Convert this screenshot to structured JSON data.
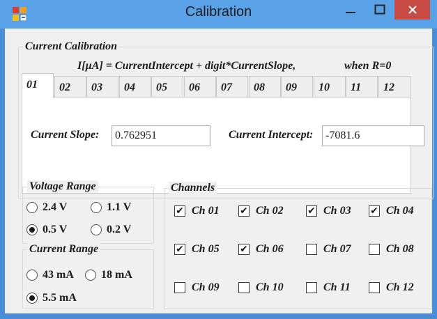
{
  "window": {
    "title": "Calibration"
  },
  "current_calibration": {
    "legend": "Current Calibration",
    "formula": "I[µA] = CurrentIntercept + digit*CurrentSlope,",
    "formula_condition": "when R=0",
    "tabs": [
      "01",
      "02",
      "03",
      "04",
      "05",
      "06",
      "07",
      "08",
      "09",
      "10",
      "11",
      "12"
    ],
    "active_tab": "01",
    "slope_label": "Current Slope:",
    "slope_value": "0.762951",
    "intercept_label": "Current Intercept:",
    "intercept_value": "-7081.6"
  },
  "voltage_range": {
    "legend": "Voltage Range",
    "options": [
      {
        "label": "2.4 V",
        "selected": false
      },
      {
        "label": "1.1 V",
        "selected": false
      },
      {
        "label": "0.5 V",
        "selected": true
      },
      {
        "label": "0.2 V",
        "selected": false
      }
    ]
  },
  "current_range": {
    "legend": "Current Range",
    "options": [
      {
        "label": "43 mA",
        "selected": false
      },
      {
        "label": "18 mA",
        "selected": false
      },
      {
        "label": "5.5 mA",
        "selected": true
      }
    ]
  },
  "channels": {
    "legend": "Channels",
    "items": [
      {
        "label": "Ch 01",
        "checked": true
      },
      {
        "label": "Ch 02",
        "checked": true
      },
      {
        "label": "Ch 03",
        "checked": true
      },
      {
        "label": "Ch 04",
        "checked": true
      },
      {
        "label": "Ch 05",
        "checked": true
      },
      {
        "label": "Ch 06",
        "checked": true
      },
      {
        "label": "Ch 07",
        "checked": false
      },
      {
        "label": "Ch 08",
        "checked": false
      },
      {
        "label": "Ch 09",
        "checked": false
      },
      {
        "label": "Ch 10",
        "checked": false
      },
      {
        "label": "Ch 11",
        "checked": false
      },
      {
        "label": "Ch 12",
        "checked": false
      }
    ]
  },
  "colors": {
    "titlebar": "#5aa2e8",
    "close": "#c84a44",
    "client": "#f0f0f0"
  }
}
